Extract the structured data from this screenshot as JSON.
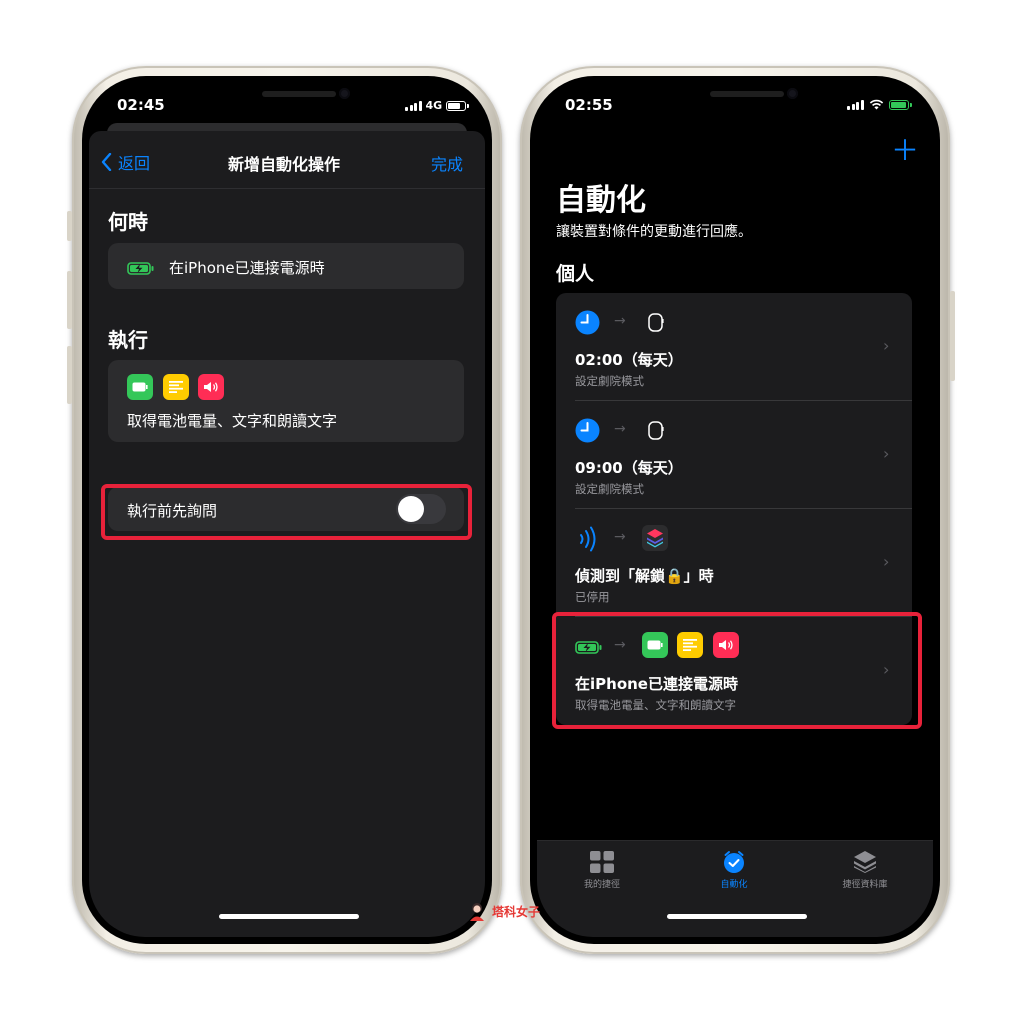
{
  "left": {
    "time": "02:45",
    "network": "4G",
    "nav": {
      "back_label": "返回",
      "title": "新增自動化操作",
      "done_label": "完成"
    },
    "when_section": {
      "heading": "何時",
      "trigger_text": "在iPhone已連接電源時"
    },
    "do_section": {
      "heading": "執行",
      "actions_text": "取得電池電量、文字和朗讀文字"
    },
    "ask_before_running": {
      "label": "執行前先詢問",
      "enabled": false
    }
  },
  "right": {
    "time": "02:55",
    "title": "自動化",
    "subtitle": "讓裝置對條件的更動進行回應。",
    "section": "個人",
    "automations": [
      {
        "title": "02:00（每天）",
        "subtitle": "設定劇院模式"
      },
      {
        "title": "09:00（每天）",
        "subtitle": "設定劇院模式"
      },
      {
        "title": "偵測到「解鎖🔒」時",
        "subtitle": "已停用"
      },
      {
        "title": "在iPhone已連接電源時",
        "subtitle": "取得電池電量、文字和朗讀文字"
      }
    ],
    "tabs": [
      {
        "label": "我的捷徑",
        "active": false
      },
      {
        "label": "自動化",
        "active": true
      },
      {
        "label": "捷徑資料庫",
        "active": false
      }
    ]
  },
  "watermark": "塔科女子",
  "colors": {
    "accent": "#0a84ff",
    "highlight_box": "#e8223a",
    "battery_green": "#33c759",
    "background": "#000000"
  }
}
